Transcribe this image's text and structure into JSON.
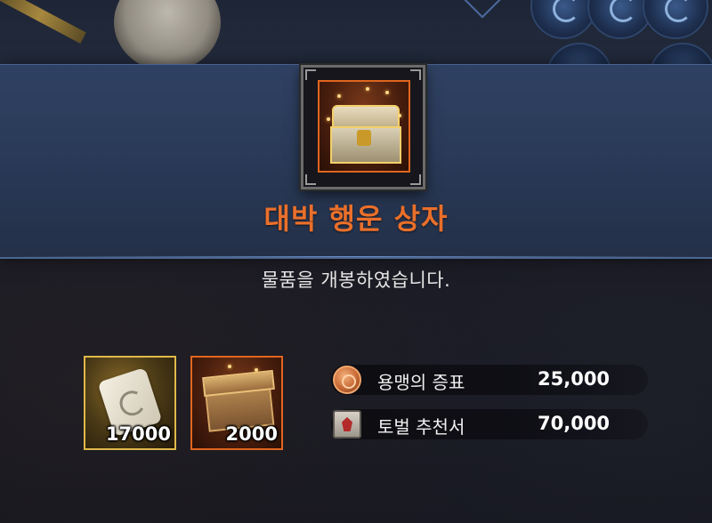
{
  "dialog": {
    "title": "대박 행운 상자",
    "message": "물품을 개봉하였습니다.",
    "opened_item_icon": "golden-treasure-chest-icon"
  },
  "rewards": {
    "items": [
      {
        "icon": "scroll-icon",
        "count": "17000",
        "frame_color": "#e0b94a"
      },
      {
        "icon": "wooden-box-icon",
        "count": "2000",
        "frame_color": "#e0661e"
      }
    ],
    "currencies": [
      {
        "icon": "mercenary-coin-icon",
        "name": "용맹의 증표",
        "amount": "25,000"
      },
      {
        "icon": "subjugation-book-icon",
        "name": "토벌 추천서",
        "amount": "70,000"
      }
    ]
  },
  "colors": {
    "title": "#ea6f2a",
    "banner": "#2f4163"
  }
}
